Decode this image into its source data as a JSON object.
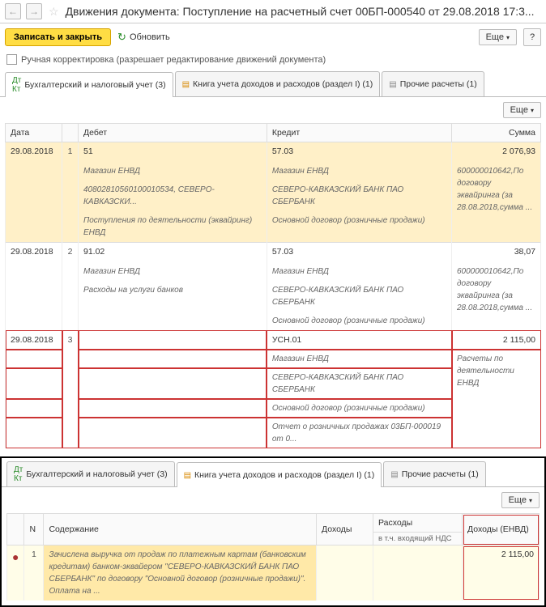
{
  "header": {
    "title": "Движения документа: Поступление на расчетный счет 00БП-000540 от 29.08.2018 17:3..."
  },
  "cmdbar": {
    "save_close": "Записать и закрыть",
    "refresh": "Обновить",
    "more": "Еще",
    "help": "?"
  },
  "manual_edit": {
    "label": "Ручная корректировка (разрешает редактирование движений документа)"
  },
  "tabs1": {
    "t1": "Бухгалтерский и налоговый учет (3)",
    "t2": "Книга учета доходов и расходов (раздел I) (1)",
    "t3": "Прочие расчеты (1)"
  },
  "table1": {
    "cols": {
      "date": "Дата",
      "debit": "Дебет",
      "credit": "Кредит",
      "sum": "Сумма"
    },
    "r1": {
      "date": "29.08.2018",
      "n": "1",
      "d1": "51",
      "d2": "Магазин ЕНВД",
      "d3": "40802810560100010534, СЕВЕРО-КАВКАЗСКИ...",
      "d4": "Поступления по деятельности (эквайринг) ЕНВД",
      "c1": "57.03",
      "c2": "Магазин ЕНВД",
      "c3": "СЕВЕРО-КАВКАЗСКИЙ БАНК ПАО СБЕРБАНК",
      "c4": "Основной договор (розничные продажи)",
      "s1": "2 076,93",
      "s2": "600000010642,По договору эквайринга (за 28.08.2018,сумма ..."
    },
    "r2": {
      "date": "29.08.2018",
      "n": "2",
      "d1": "91.02",
      "d2": "Магазин ЕНВД",
      "d3": "Расходы на услуги банков",
      "c1": "57.03",
      "c2": "Магазин ЕНВД",
      "c3": "СЕВЕРО-КАВКАЗСКИЙ БАНК ПАО СБЕРБАНК",
      "c4": "Основной договор (розничные продажи)",
      "s1": "38,07",
      "s2": "600000010642,По договору эквайринга (за 28.08.2018,сумма ..."
    },
    "r3": {
      "date": "29.08.2018",
      "n": "3",
      "c1": "УСН.01",
      "c2": "Магазин ЕНВД",
      "c3": "СЕВЕРО-КАВКАЗСКИЙ БАНК ПАО СБЕРБАНК",
      "c4": "Основной договор (розничные продажи)",
      "c5": "Отчет о розничных продажах 03БП-000019 от 0...",
      "s1": "2 115,00",
      "s2": "Расчеты по деятельности ЕНВД"
    }
  },
  "tabs2": {
    "t1": "Бухгалтерский и налоговый учет (3)",
    "t2": "Книга учета доходов и расходов (раздел I) (1)",
    "t3": "Прочие расчеты (1)"
  },
  "table2": {
    "cols": {
      "n": "N",
      "content": "Содержание",
      "income": "Доходы",
      "expense": "Расходы",
      "vat": "в т.ч. входящий НДС",
      "income_envd": "Доходы (ЕНВД)"
    },
    "r1": {
      "n": "1",
      "content": "Зачислена выручка от продаж по платежным картам (банковским кредитам) банком-эквайером \"СЕВЕРО-КАВКАЗСКИЙ БАНК ПАО СБЕРБАНК\" по договору \"Основной договор (розничные продажи)\". Оплата на ...",
      "income_envd": "2 115,00"
    }
  }
}
